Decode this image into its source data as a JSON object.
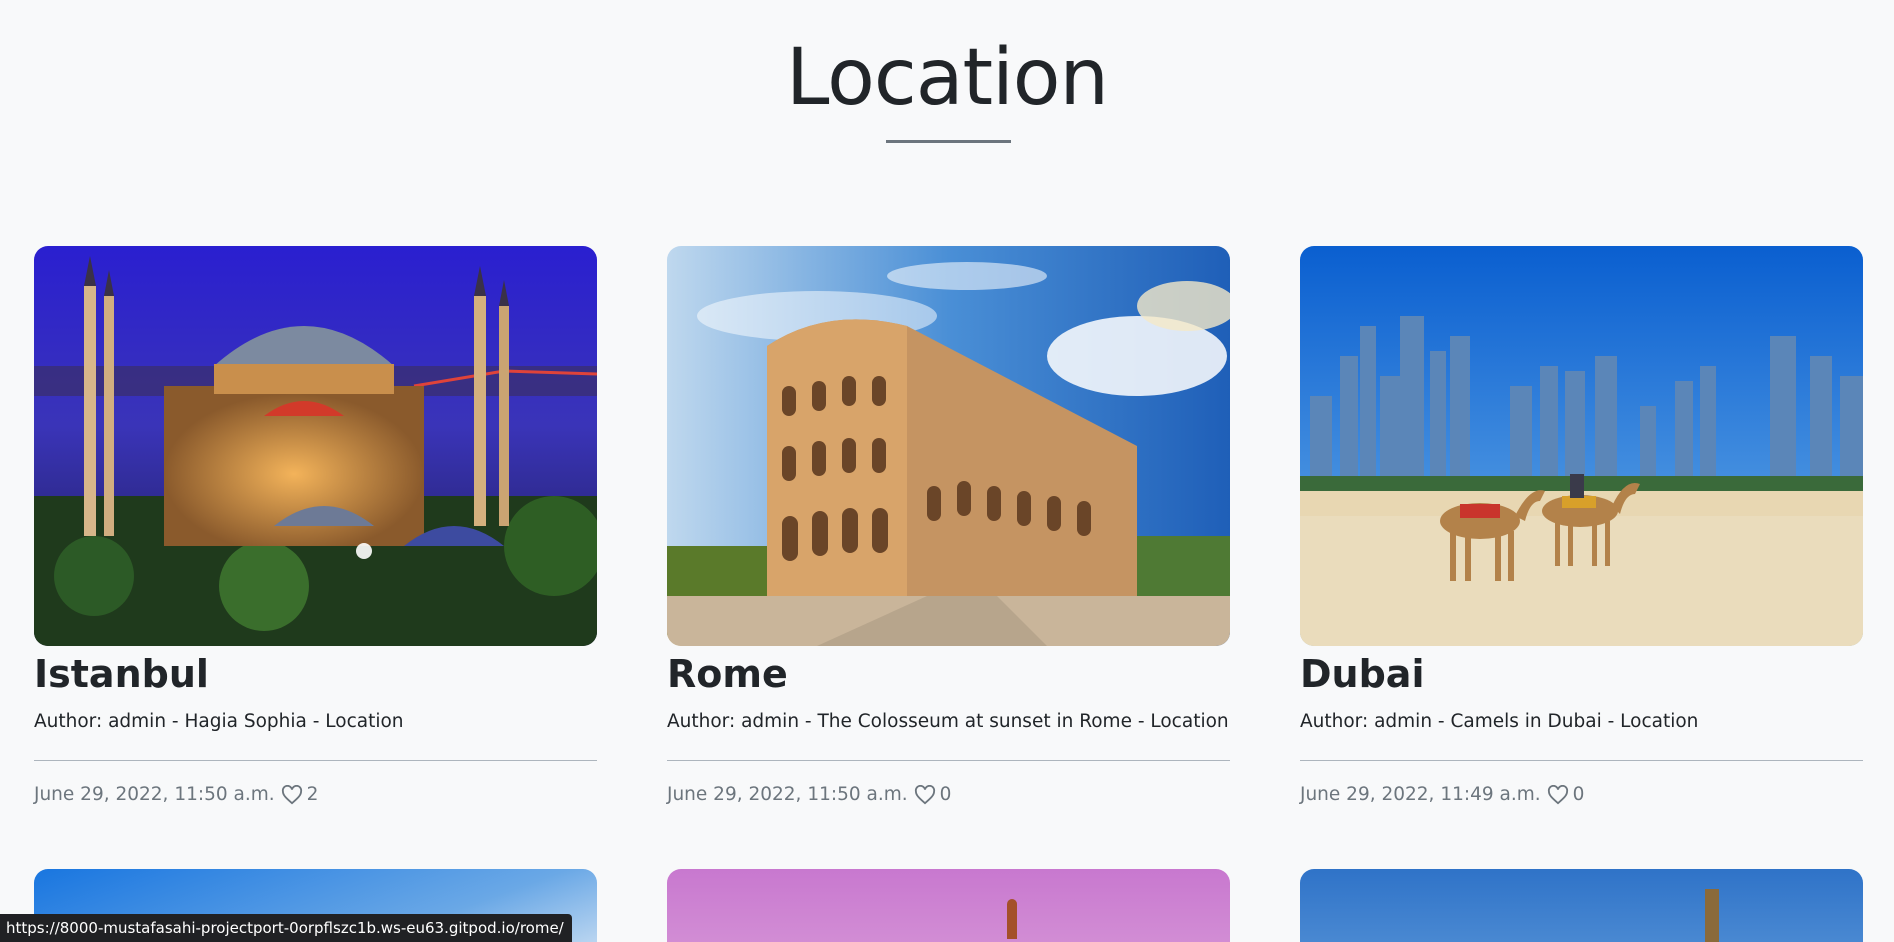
{
  "page": {
    "title": "Location"
  },
  "cards": [
    {
      "title": "Istanbul",
      "text": "Author: admin - Hagia Sophia - Location",
      "date": "June 29, 2022, 11:50 a.m.",
      "likes": "2",
      "image": "hagia-sophia-night"
    },
    {
      "title": "Rome",
      "text": "Author: admin - The Colosseum at sunset in Rome - Location",
      "date": "June 29, 2022, 11:50 a.m.",
      "likes": "0",
      "image": "colosseum-sunset"
    },
    {
      "title": "Dubai",
      "text": "Author: admin - Camels in Dubai - Location",
      "date": "June 29, 2022, 11:49 a.m.",
      "likes": "0",
      "image": "camels-dubai-beach"
    }
  ],
  "status_bar": {
    "url": "https://8000-mustafasahi-projectport-0orpflszc1b.ws-eu63.gitpod.io/rome/"
  },
  "colors": {
    "background": "#f8f9fa",
    "text": "#212529",
    "muted": "#6c757d"
  }
}
